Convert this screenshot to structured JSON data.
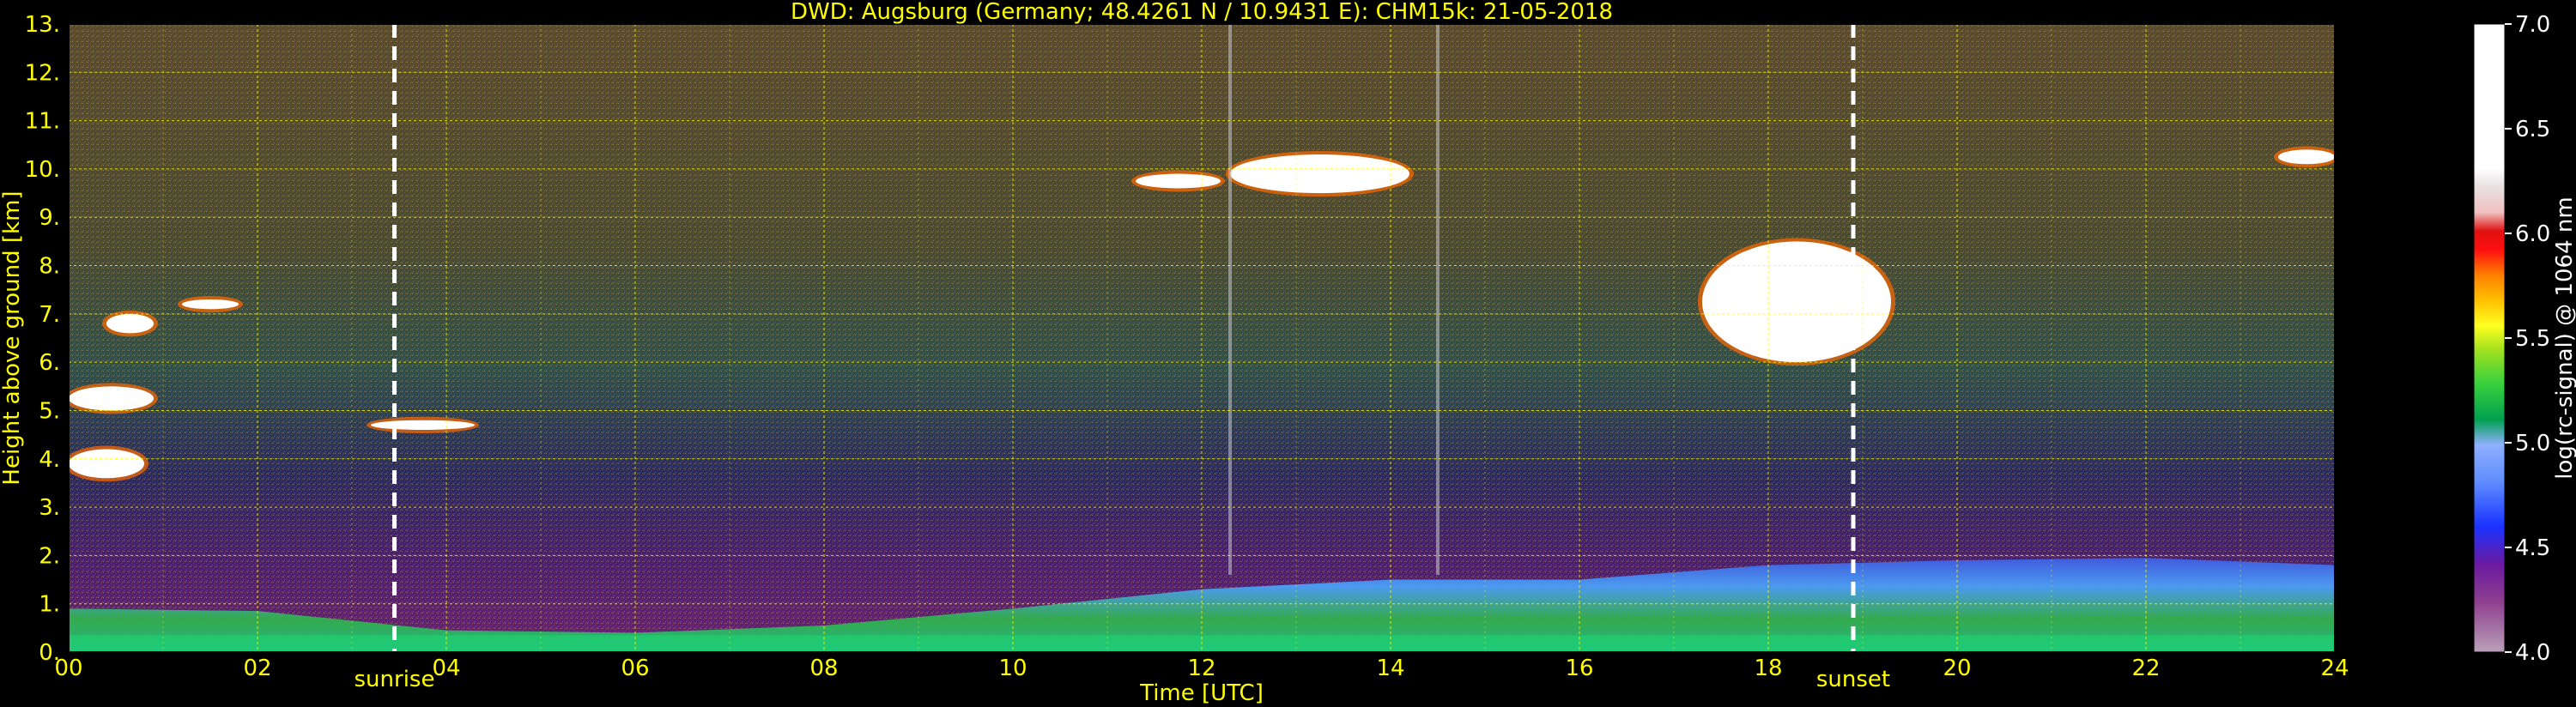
{
  "chart_data": {
    "type": "heatmap",
    "title": "DWD: Augsburg (Germany; 48.4261 N / 10.9431 E):    CHM15k: 21-05-2018",
    "xlabel": "Time [UTC]",
    "ylabel": "Height above ground [km]",
    "xlim": [
      0,
      24
    ],
    "ylim": [
      0,
      13
    ],
    "x_ticks": [
      "00",
      "02",
      "04",
      "06",
      "08",
      "10",
      "12",
      "14",
      "16",
      "18",
      "20",
      "22",
      "24"
    ],
    "y_ticks": [
      "0.",
      "1.",
      "2.",
      "3.",
      "4.",
      "5.",
      "6.",
      "7.",
      "8.",
      "9.",
      "10.",
      "11.",
      "12.",
      "13."
    ],
    "grid": true,
    "events": [
      {
        "label": "sunrise",
        "x": 3.45
      },
      {
        "label": "sunset",
        "x": 18.9
      }
    ],
    "colorbar": {
      "label": "log(rc-signal) @ 1064 nm",
      "min": 4.0,
      "max": 7.0,
      "ticks": [
        "4.0",
        "4.5",
        "5.0",
        "5.5",
        "6.0",
        "6.5",
        "7.0"
      ]
    },
    "features": {
      "boundary_layer_top_km": [
        [
          0,
          0.9
        ],
        [
          2,
          0.85
        ],
        [
          4,
          0.45
        ],
        [
          6,
          0.4
        ],
        [
          8,
          0.55
        ],
        [
          10,
          0.9
        ],
        [
          12,
          1.3
        ],
        [
          14,
          1.5
        ],
        [
          16,
          1.5
        ],
        [
          18,
          1.8
        ],
        [
          20,
          1.9
        ],
        [
          22,
          1.95
        ],
        [
          24,
          1.8
        ]
      ],
      "clouds": [
        {
          "x0": 0.0,
          "x1": 0.8,
          "y0": 3.6,
          "y1": 4.2
        },
        {
          "x0": 0.0,
          "x1": 0.9,
          "y0": 5.0,
          "y1": 5.5
        },
        {
          "x0": 0.4,
          "x1": 0.9,
          "y0": 6.6,
          "y1": 7.0
        },
        {
          "x0": 1.2,
          "x1": 1.8,
          "y0": 7.1,
          "y1": 7.3
        },
        {
          "x0": 3.2,
          "x1": 4.3,
          "y0": 4.6,
          "y1": 4.8
        },
        {
          "x0": 11.3,
          "x1": 12.2,
          "y0": 9.6,
          "y1": 9.9
        },
        {
          "x0": 12.3,
          "x1": 14.2,
          "y0": 9.5,
          "y1": 10.3
        },
        {
          "x0": 17.3,
          "x1": 19.3,
          "y0": 6.0,
          "y1": 8.5
        },
        {
          "x0": 23.4,
          "x1": 24.0,
          "y0": 10.1,
          "y1": 10.4
        }
      ],
      "streaks_x": [
        12.3,
        14.5
      ]
    }
  }
}
